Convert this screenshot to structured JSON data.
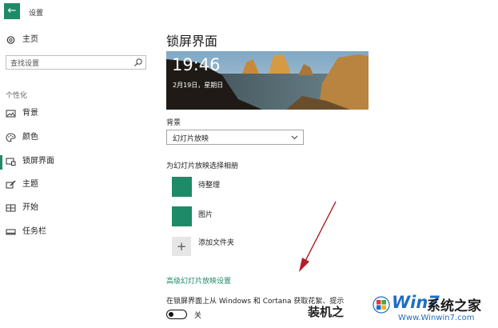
{
  "app": {
    "title": "设置",
    "back_icon": "back-arrow-icon"
  },
  "sidebar": {
    "home": {
      "label": "主页",
      "icon": "gear-icon"
    },
    "search": {
      "placeholder": "查找设置",
      "icon": "search-icon"
    },
    "section": "个性化",
    "items": [
      {
        "label": "背景",
        "icon": "picture-icon"
      },
      {
        "label": "颜色",
        "icon": "palette-icon"
      },
      {
        "label": "锁屏界面",
        "icon": "lockscreen-icon",
        "active": true
      },
      {
        "label": "主题",
        "icon": "brush-icon"
      },
      {
        "label": "开始",
        "icon": "start-icon"
      },
      {
        "label": "任务栏",
        "icon": "taskbar-icon"
      }
    ]
  },
  "main": {
    "title": "锁屏界面",
    "preview": {
      "time": "19:46",
      "date": "2月19日，星期日"
    },
    "background_label": "背景",
    "background_value": "幻灯片放映",
    "albums_label": "为幻灯片放映选择相册",
    "albums": [
      {
        "label": "待整理"
      },
      {
        "label": "图片"
      }
    ],
    "add_folder": "添加文件夹",
    "advanced_link": "高级幻灯片放映设置",
    "fun_facts_desc": "在锁屏界面上从 Windows 和 Cortana 获取花絮、提示",
    "fun_facts_toggle": "关"
  },
  "watermark": {
    "text": "装机之",
    "brand": "Win7",
    "brand_cn": "系统之家",
    "url": "Www.Winwin7.com"
  },
  "colors": {
    "accent": "#1e8a68"
  }
}
